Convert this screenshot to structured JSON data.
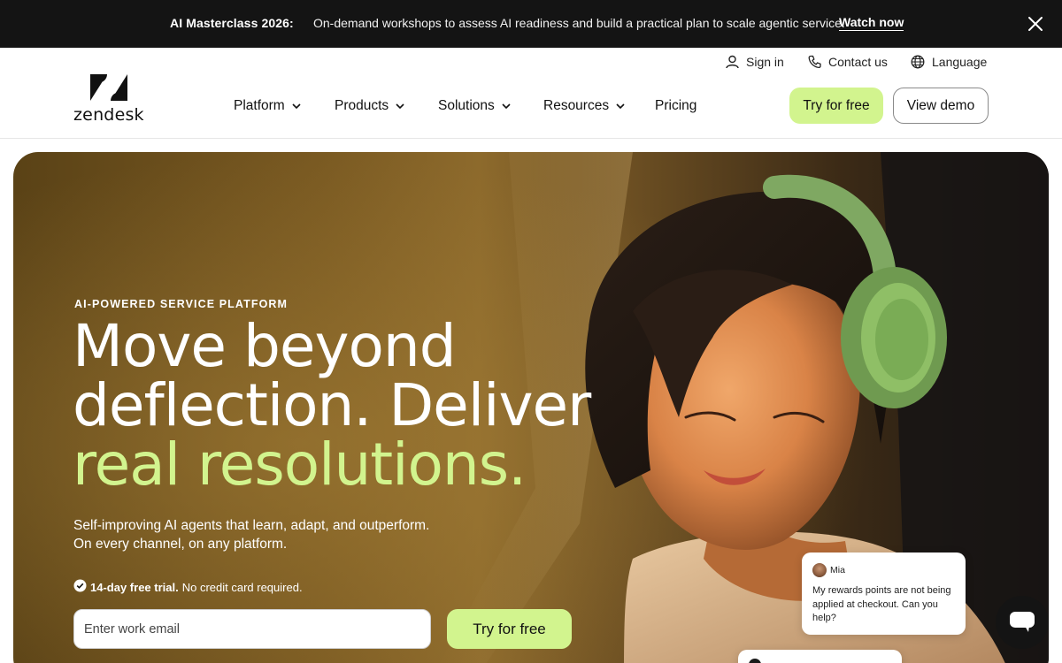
{
  "announcement": {
    "title": "AI Masterclass 2026:",
    "text": "On-demand workshops to assess AI readiness and build a practical plan to scale agentic service.",
    "link_label": "Watch now",
    "close_icon": "close-icon"
  },
  "header": {
    "logo_text": "zendesk",
    "utility": [
      {
        "label": "Sign in",
        "icon": "person-icon"
      },
      {
        "label": "Contact us",
        "icon": "phone-icon"
      },
      {
        "label": "Language",
        "icon": "globe-icon"
      }
    ],
    "nav": [
      {
        "label": "Platform",
        "has_dropdown": true
      },
      {
        "label": "Products",
        "has_dropdown": true
      },
      {
        "label": "Solutions",
        "has_dropdown": true
      },
      {
        "label": "Resources",
        "has_dropdown": true
      },
      {
        "label": "Pricing",
        "has_dropdown": false
      }
    ],
    "try_label": "Try for free",
    "demo_label": "View demo"
  },
  "hero": {
    "eyebrow": "AI-POWERED SERVICE PLATFORM",
    "headline_line1": "Move beyond",
    "headline_line2": "deflection. Deliver",
    "headline_accent": "real resolutions.",
    "sub_line1": "Self-improving AI agents that learn, adapt, and outperform.",
    "sub_line2": "On every channel, on any platform.",
    "trial_bold": "14-day free trial.",
    "trial_rest": "No credit card required.",
    "email_placeholder": "Enter work email",
    "try_label": "Try for free"
  },
  "chat_card": {
    "name": "Mia",
    "message": "My rewards points are not being applied at checkout. Can you help?"
  },
  "colors": {
    "accent": "#d2f48e",
    "topbar": "#141414",
    "text": "#111111"
  }
}
